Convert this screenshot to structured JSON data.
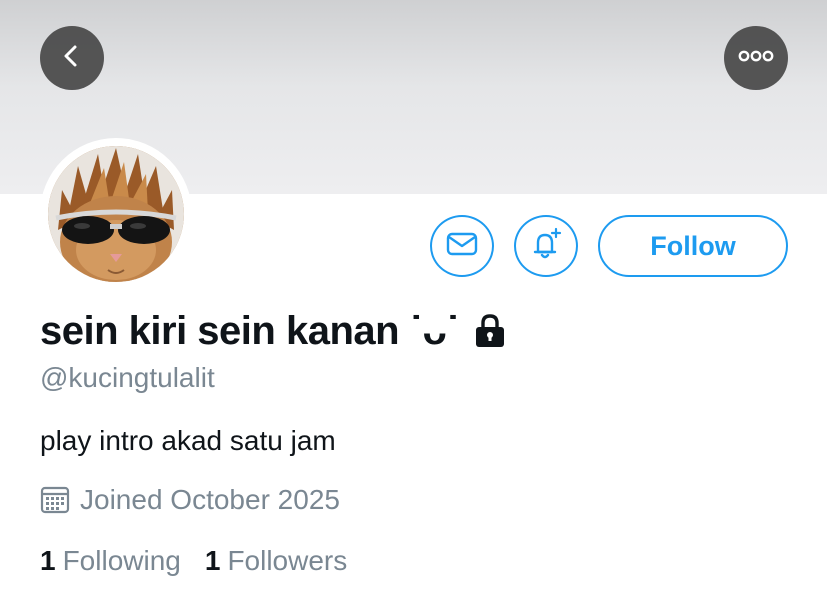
{
  "header": {
    "back_icon": "chevron-left-icon",
    "more_icon": "more-horizontal-icon"
  },
  "profile": {
    "avatar_description_icon": "cat-with-sunglasses-avatar",
    "display_name": "sein kiri sein kanan ˙⁠ᴗ⁠˙",
    "protected_icon": "lock-icon",
    "handle": "@kucingtulalit",
    "bio": "play intro akad satu jam",
    "joined": "Joined October 2025",
    "following_count": "1",
    "following_label": "Following",
    "followers_count": "1",
    "followers_label": "Followers"
  },
  "actions": {
    "message_icon": "mail-icon",
    "notify_icon": "bell-plus-icon",
    "follow_label": "Follow"
  },
  "colors": {
    "accent": "#1d9bf0",
    "secondary_text": "#7a8792",
    "primary_text": "#0f1419",
    "overlay_button": "#484848"
  }
}
